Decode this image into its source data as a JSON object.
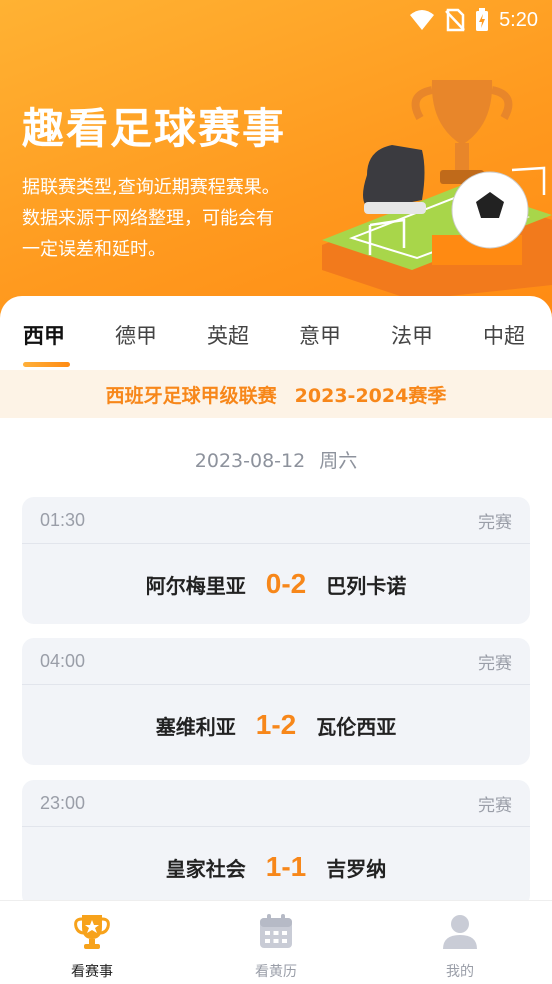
{
  "status_bar": {
    "time": "5:20"
  },
  "hero": {
    "title": "趣看足球赛事",
    "desc_lines": [
      "据联赛类型,查询近期赛程赛果。",
      "数据来源于网络整理，可能会有",
      "一定误差和延时。"
    ]
  },
  "tabs": [
    {
      "label": "西甲",
      "active": true
    },
    {
      "label": "德甲",
      "active": false
    },
    {
      "label": "英超",
      "active": false
    },
    {
      "label": "意甲",
      "active": false
    },
    {
      "label": "法甲",
      "active": false
    },
    {
      "label": "中超",
      "active": false
    }
  ],
  "league": {
    "name": "西班牙足球甲级联赛",
    "season": "2023-2024赛季"
  },
  "date": {
    "day": "2023-08-12",
    "weekday": "周六"
  },
  "matches": [
    {
      "time": "01:30",
      "status": "完赛",
      "home": "阿尔梅里亚",
      "score": "0-2",
      "away": "巴列卡诺"
    },
    {
      "time": "04:00",
      "status": "完赛",
      "home": "塞维利亚",
      "score": "1-2",
      "away": "瓦伦西亚"
    },
    {
      "time": "23:00",
      "status": "完赛",
      "home": "皇家社会",
      "score": "1-1",
      "away": "吉罗纳"
    }
  ],
  "bottom_nav": [
    {
      "label": "看赛事",
      "icon": "trophy-icon",
      "active": true
    },
    {
      "label": "看黄历",
      "icon": "calendar-icon",
      "active": false
    },
    {
      "label": "我的",
      "icon": "user-icon",
      "active": false
    }
  ],
  "colors": {
    "accent": "#f7871a",
    "hero": "#ff9a1f",
    "league_bg": "#fdf3e6",
    "card_bg": "#f2f4f8"
  }
}
